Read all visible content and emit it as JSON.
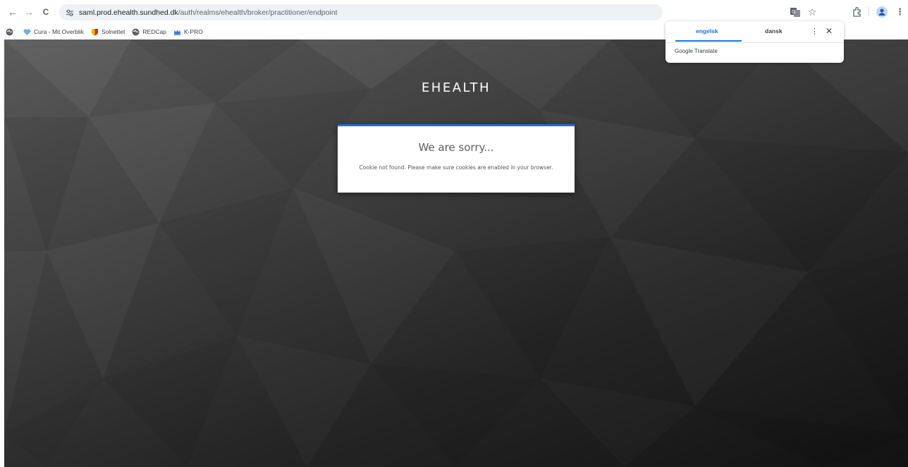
{
  "browser": {
    "url_host": "saml.prod.ehealth.sundhed.dk",
    "url_path": "/auth/realms/ehealth/broker/practitioner/endpoint",
    "nav": {
      "back": "←",
      "forward": "→",
      "reload": "C"
    },
    "toolbar_glyphs": {
      "star": "☆",
      "menu": "⋮"
    }
  },
  "bookmarks": [
    {
      "label": "",
      "icon": "globe-icon"
    },
    {
      "label": "Cura - Mit Overblik",
      "icon": "heart-icon"
    },
    {
      "label": "Solnettet",
      "icon": "shield-icon"
    },
    {
      "label": "REDCap",
      "icon": "globe-icon"
    },
    {
      "label": "K-PRO",
      "icon": "crown-icon"
    }
  ],
  "page": {
    "brand": "EHEALTH",
    "card_title": "We are sorry...",
    "card_message": "Cookie not found. Please make sure cookies are enabled in your browser."
  },
  "translate": {
    "tab_source": "engelsk",
    "tab_target": "dansk",
    "menu_glyph": "⋮",
    "close_glyph": "✕",
    "footer": "Google Translate"
  },
  "colors": {
    "accent": "#1d6fe0",
    "translate_accent": "#1a73e8",
    "background_dark": "#121212",
    "background_light": "#5a5a5a"
  }
}
